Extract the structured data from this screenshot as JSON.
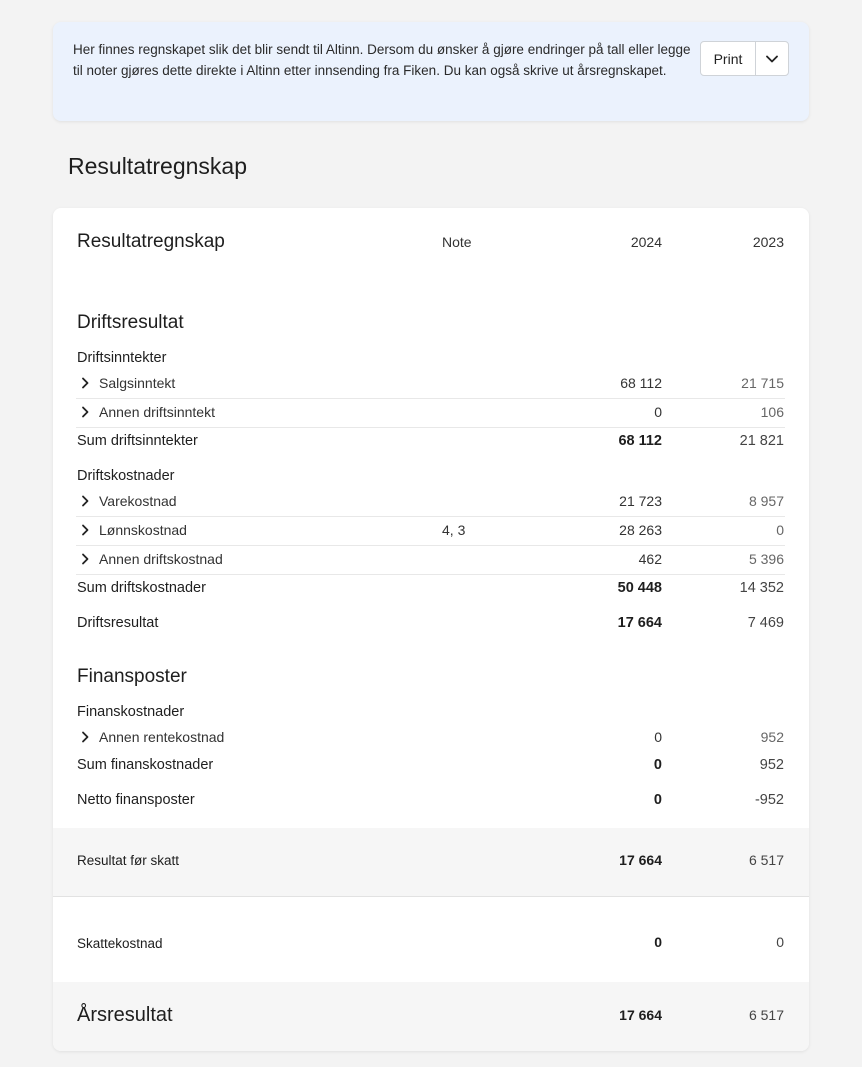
{
  "banner": {
    "text": "Her finnes regnskapet slik det blir sendt til Altinn. Dersom du ønsker å gjøre endringer på tall eller legge til noter gjøres dette direkte i Altinn etter innsending fra Fiken. Du kan også skrive ut årsregnskapet.",
    "print_label": "Print",
    "dropdown_icon": "chevron-down-icon"
  },
  "page_title": "Resultatregnskap",
  "statement": {
    "title": "Resultatregnskap",
    "columns": {
      "note": "Note",
      "y1": "2024",
      "y2": "2023"
    },
    "driftsresultat": {
      "heading": "Driftsresultat",
      "inntekter": {
        "heading": "Driftsinntekter",
        "lines": [
          {
            "label": "Salgsinntekt",
            "note": "",
            "y1": "68 112",
            "y2": "21 715"
          },
          {
            "label": "Annen driftsinntekt",
            "note": "",
            "y1": "0",
            "y2": "106"
          }
        ],
        "sum_label": "Sum driftsinntekter",
        "sum_y1": "68 112",
        "sum_y2": "21 821"
      },
      "kostnader": {
        "heading": "Driftskostnader",
        "lines": [
          {
            "label": "Varekostnad",
            "note": "",
            "y1": "21 723",
            "y2": "8 957"
          },
          {
            "label": "Lønnskostnad",
            "note": "4, 3",
            "y1": "28 263",
            "y2": "0"
          },
          {
            "label": "Annen driftskostnad",
            "note": "",
            "y1": "462",
            "y2": "5 396"
          }
        ],
        "sum_label": "Sum driftskostnader",
        "sum_y1": "50 448",
        "sum_y2": "14 352"
      },
      "result_label": "Driftsresultat",
      "result_y1": "17 664",
      "result_y2": "7 469"
    },
    "finansposter": {
      "heading": "Finansposter",
      "kostnader": {
        "heading": "Finanskostnader",
        "lines": [
          {
            "label": "Annen rentekostnad",
            "note": "",
            "y1": "0",
            "y2": "952"
          }
        ],
        "sum_label": "Sum finanskostnader",
        "sum_y1": "0",
        "sum_y2": "952"
      },
      "netto_label": "Netto finansposter",
      "netto_y1": "0",
      "netto_y2": "-952"
    },
    "resultat_for_skatt": {
      "label": "Resultat før skatt",
      "y1": "17 664",
      "y2": "6 517"
    },
    "skattekostnad": {
      "label": "Skattekostnad",
      "y1": "0",
      "y2": "0"
    },
    "arsresultat": {
      "label": "Årsresultat",
      "y1": "17 664",
      "y2": "6 517"
    }
  }
}
